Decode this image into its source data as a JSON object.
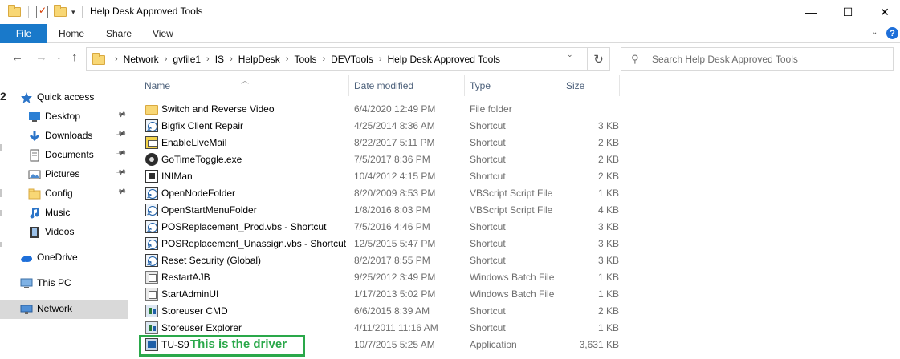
{
  "window": {
    "title": "Help Desk Approved Tools",
    "controls": {
      "minimize": "—",
      "maximize": "☐",
      "close": "✕"
    }
  },
  "ribbon": {
    "tabs": [
      "File",
      "Home",
      "Share",
      "View"
    ],
    "help": "?"
  },
  "nav": {
    "breadcrumbs": [
      "Network",
      "gvfile1",
      "IS",
      "HelpDesk",
      "Tools",
      "DEVTools",
      "Help Desk Approved Tools"
    ],
    "search_placeholder": "Search Help Desk Approved Tools"
  },
  "sidebar": {
    "items": [
      {
        "label": "Quick access",
        "icon": "star-icon"
      },
      {
        "label": "Desktop",
        "icon": "desktop-icon",
        "pinned": true
      },
      {
        "label": "Downloads",
        "icon": "download-arrow-icon",
        "pinned": true
      },
      {
        "label": "Documents",
        "icon": "document-icon",
        "pinned": true
      },
      {
        "label": "Pictures",
        "icon": "picture-icon",
        "pinned": true
      },
      {
        "label": "Config",
        "icon": "folder-icon",
        "pinned": true
      },
      {
        "label": "Music",
        "icon": "music-note-icon"
      },
      {
        "label": "Videos",
        "icon": "film-icon"
      },
      {
        "label": "OneDrive",
        "icon": "cloud-icon"
      },
      {
        "label": "This PC",
        "icon": "computer-icon"
      },
      {
        "label": "Network",
        "icon": "network-icon",
        "selected": true
      }
    ]
  },
  "columns": [
    "Name",
    "Date modified",
    "Type",
    "Size"
  ],
  "files": [
    {
      "name": "Switch and Reverse Video",
      "date": "6/4/2020 12:49 PM",
      "type": "File folder",
      "size": "",
      "icon": "folder-icon"
    },
    {
      "name": "Bigfix Client Repair",
      "date": "4/25/2014 8:36 AM",
      "type": "Shortcut",
      "size": "3 KB",
      "icon": "shortcut-icon"
    },
    {
      "name": "EnableLiveMail",
      "date": "8/22/2017 5:11 PM",
      "type": "Shortcut",
      "size": "2 KB",
      "icon": "mail-shortcut-icon"
    },
    {
      "name": "GoTimeToggle.exe",
      "date": "7/5/2017 8:36 PM",
      "type": "Shortcut",
      "size": "2 KB",
      "icon": "exe-shortcut-icon"
    },
    {
      "name": "INIMan",
      "date": "10/4/2012 4:15 PM",
      "type": "Shortcut",
      "size": "2 KB",
      "icon": "ini-shortcut-icon"
    },
    {
      "name": "OpenNodeFolder",
      "date": "8/20/2009 8:53 PM",
      "type": "VBScript Script File",
      "size": "1 KB",
      "icon": "vbscript-icon"
    },
    {
      "name": "OpenStartMenuFolder",
      "date": "1/8/2016 8:03 PM",
      "type": "VBScript Script File",
      "size": "4 KB",
      "icon": "vbscript-icon"
    },
    {
      "name": "POSReplacement_Prod.vbs - Shortcut",
      "date": "7/5/2016 4:46 PM",
      "type": "Shortcut",
      "size": "3 KB",
      "icon": "shortcut-icon"
    },
    {
      "name": "POSReplacement_Unassign.vbs - Shortcut",
      "date": "12/5/2015 5:47 PM",
      "type": "Shortcut",
      "size": "3 KB",
      "icon": "shortcut-icon"
    },
    {
      "name": "Reset Security (Global)",
      "date": "8/2/2017 8:55 PM",
      "type": "Shortcut",
      "size": "3 KB",
      "icon": "shortcut-icon"
    },
    {
      "name": "RestartAJB",
      "date": "9/25/2012 3:49 PM",
      "type": "Windows Batch File",
      "size": "1 KB",
      "icon": "batch-file-icon"
    },
    {
      "name": "StartAdminUI",
      "date": "1/17/2013 5:02 PM",
      "type": "Windows Batch File",
      "size": "1 KB",
      "icon": "batch-file-icon"
    },
    {
      "name": "Storeuser CMD",
      "date": "6/6/2015 8:39 AM",
      "type": "Shortcut",
      "size": "2 KB",
      "icon": "storeuser-icon"
    },
    {
      "name": "Storeuser Explorer",
      "date": "4/11/2011 11:16 AM",
      "type": "Shortcut",
      "size": "1 KB",
      "icon": "storeuser-icon"
    },
    {
      "name": "TU-S9",
      "date": "10/7/2015 5:25 AM",
      "type": "Application",
      "size": "3,631 KB",
      "icon": "application-icon"
    }
  ],
  "annotation": {
    "text": "This is the driver",
    "color": "#2aa84a"
  },
  "left_edge_glyph": "2",
  "colors": {
    "file_tab": "#1979ca",
    "selected_nav": "#d9d9d9",
    "header_text": "#4c607a"
  }
}
